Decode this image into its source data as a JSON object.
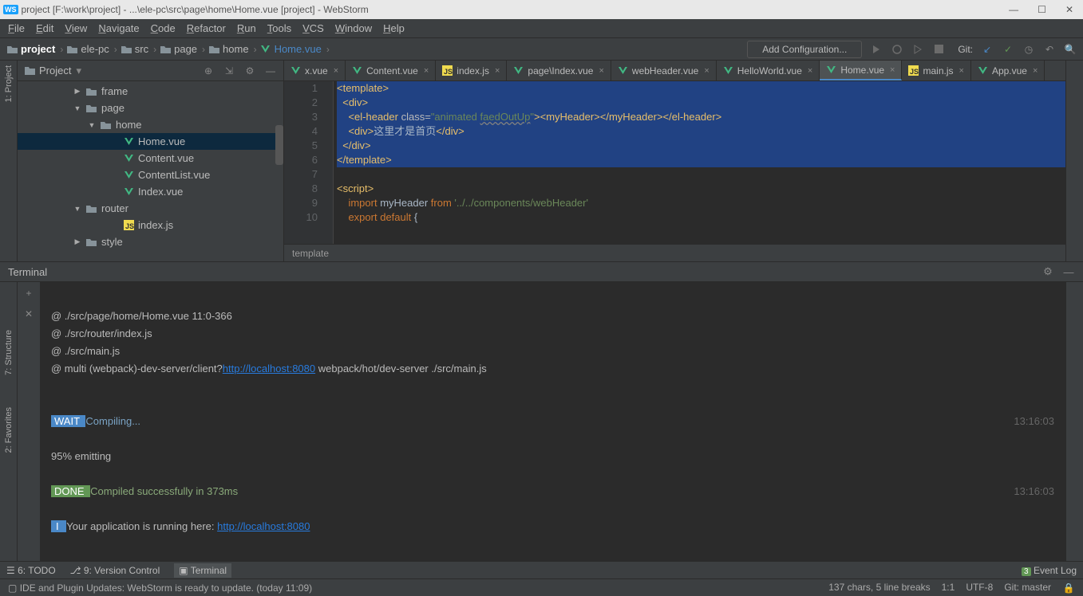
{
  "title": "project [F:\\work\\project] - ...\\ele-pc\\src\\page\\home\\Home.vue [project] - WebStorm",
  "menu": [
    "File",
    "Edit",
    "View",
    "Navigate",
    "Code",
    "Refactor",
    "Run",
    "Tools",
    "VCS",
    "Window",
    "Help"
  ],
  "breadcrumb": [
    {
      "icon": "folder",
      "label": "project"
    },
    {
      "icon": "folder",
      "label": "ele-pc"
    },
    {
      "icon": "folder",
      "label": "src"
    },
    {
      "icon": "folder",
      "label": "page"
    },
    {
      "icon": "folder",
      "label": "home"
    },
    {
      "icon": "vue",
      "label": "Home.vue"
    }
  ],
  "addcfg": "Add Configuration...",
  "git_label": "Git:",
  "project_panel_title": "Project",
  "tree": [
    {
      "indent": 70,
      "tw": "▶",
      "icon": "folder",
      "label": "frame"
    },
    {
      "indent": 70,
      "tw": "▼",
      "icon": "folder",
      "label": "page"
    },
    {
      "indent": 88,
      "tw": "▼",
      "icon": "folder",
      "label": "home"
    },
    {
      "indent": 118,
      "tw": "",
      "icon": "vue",
      "label": "Home.vue",
      "sel": true
    },
    {
      "indent": 118,
      "tw": "",
      "icon": "vue",
      "label": "Content.vue"
    },
    {
      "indent": 118,
      "tw": "",
      "icon": "vue",
      "label": "ContentList.vue"
    },
    {
      "indent": 118,
      "tw": "",
      "icon": "vue",
      "label": "Index.vue"
    },
    {
      "indent": 70,
      "tw": "▼",
      "icon": "folder",
      "label": "router"
    },
    {
      "indent": 118,
      "tw": "",
      "icon": "js",
      "label": "index.js"
    },
    {
      "indent": 70,
      "tw": "▶",
      "icon": "folder",
      "label": "style"
    }
  ],
  "tabs": [
    {
      "icon": "vue",
      "label": "x.vue"
    },
    {
      "icon": "vue",
      "label": "Content.vue"
    },
    {
      "icon": "js",
      "label": "index.js"
    },
    {
      "icon": "vue",
      "label": "page\\Index.vue"
    },
    {
      "icon": "vue",
      "label": "webHeader.vue"
    },
    {
      "icon": "vue",
      "label": "HelloWorld.vue"
    },
    {
      "icon": "vue",
      "label": "Home.vue",
      "active": true
    },
    {
      "icon": "js",
      "label": "main.js"
    },
    {
      "icon": "vue",
      "label": "App.vue"
    }
  ],
  "code_lines": 10,
  "code_breadcrumb": "template",
  "terminal": {
    "title": "Terminal",
    "l1": "@ ./src/page/home/Home.vue 11:0-366",
    "l2": "@ ./src/router/index.js",
    "l3": "@ ./src/main.js",
    "l4a": "@ multi (webpack)-dev-server/client?",
    "l4b": "http://localhost:8080",
    "l4c": " webpack/hot/dev-server ./src/main.js",
    "wait_badge": " WAIT ",
    "wait_text": " Compiling...",
    "time1": "13:16:03",
    "emitting": "95% emitting",
    "done_badge": " DONE ",
    "done_text": " Compiled successfully in 373ms",
    "time2": "13:16:03",
    "info_badge": " I ",
    "info_text": " Your application is running here: ",
    "info_url": "http://localhost:8080"
  },
  "bottom": {
    "todo": "6: TODO",
    "vcs": "9: Version Control",
    "term": "Terminal",
    "event": "Event Log",
    "event_count": "3"
  },
  "status": {
    "msg": "IDE and Plugin Updates: WebStorm is ready to update. (today 11:09)",
    "chars": "137 chars, 5 line breaks",
    "pos": "1:1",
    "enc": "UTF-8",
    "branch": "Git: master"
  },
  "left_tabs": [
    "1: Project"
  ],
  "left_tabs2": [
    "7: Structure",
    "2: Favorites"
  ]
}
